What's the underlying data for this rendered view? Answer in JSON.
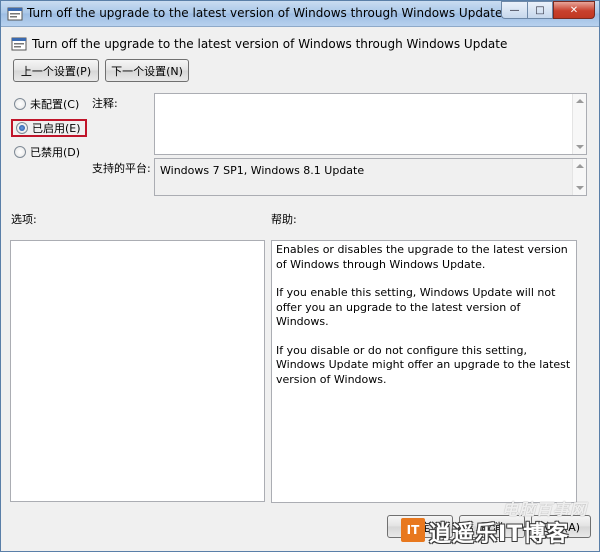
{
  "window": {
    "title": "Turn off the upgrade to the latest version of Windows through Windows Update",
    "minimize_glyph": "—",
    "maximize_glyph": "□",
    "close_glyph": "✕"
  },
  "header": {
    "policy_title": "Turn off the upgrade to the latest version of Windows through Windows Update"
  },
  "nav": {
    "prev_label": "上一个设置(P)",
    "next_label": "下一个设置(N)"
  },
  "state": {
    "options": [
      {
        "label": "未配置(C)",
        "selected": false
      },
      {
        "label": "已启用(E)",
        "selected": true
      },
      {
        "label": "已禁用(D)",
        "selected": false
      }
    ]
  },
  "fields": {
    "comment_label": "注释:",
    "comment_value": "",
    "platform_label": "支持的平台:",
    "platform_value": "Windows 7 SP1, Windows 8.1 Update"
  },
  "panes": {
    "options_label": "选项:",
    "help_label": "帮助:",
    "help_paragraphs": [
      "Enables or disables the upgrade to the latest version of Windows through Windows Update.",
      "If you enable this setting, Windows Update will not offer you an upgrade to the latest version of Windows.",
      "If you disable or do not configure this setting, Windows Update might offer an upgrade to the latest version of Windows."
    ]
  },
  "footer": {
    "ok_label": "确定",
    "cancel_label": "取消",
    "apply_label": "应用(A)"
  },
  "watermark": {
    "top_text": "电脑百事网",
    "logo_text": "IT",
    "main_text": "逍遥乐IT博客"
  },
  "colors": {
    "highlight_border": "#c0152a",
    "titlebar": "#a9c7e8",
    "close_button": "#c8402d"
  }
}
